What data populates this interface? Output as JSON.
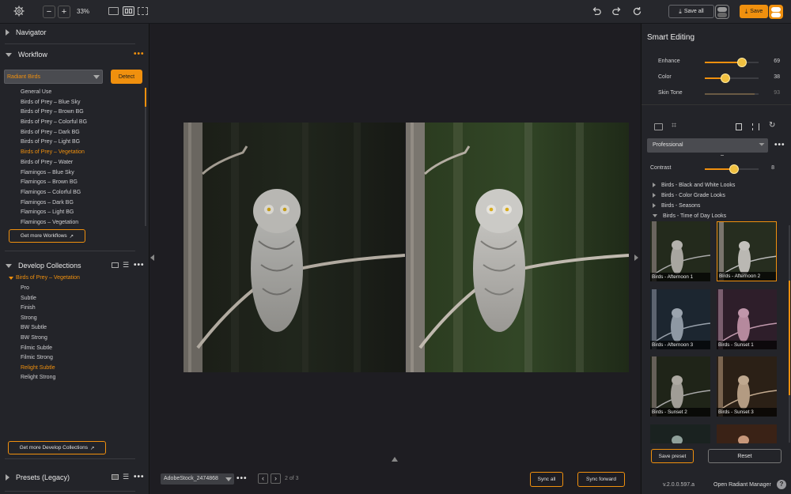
{
  "toolbar": {
    "zoom": "33%",
    "save_all_label": "Save all",
    "save_label": "Save"
  },
  "navigator": {
    "title": "Navigator"
  },
  "workflow": {
    "title": "Workflow",
    "selected": "Radiant Birds",
    "detect_label": "Detect",
    "items": [
      "General Use",
      "Birds of Prey – Blue Sky",
      "Birds of Prey – Brown BG",
      "Birds of Prey – Colorful BG",
      "Birds of Prey – Dark BG",
      "Birds of Prey – Light BG",
      "Birds of Prey – Vegetation",
      "Birds of Prey – Water",
      "Flamingos – Blue Sky",
      "Flamingos – Brown BG",
      "Flamingos – Colorful BG",
      "Flamingos – Dark BG",
      "Flamingos – Light BG",
      "Flamingos – Vegetation"
    ],
    "get_more_label": "Get more Workflows"
  },
  "develop": {
    "title": "Develop Collections",
    "group": "Birds of Prey – Vegetation",
    "items": [
      "Pro",
      "Subtle",
      "Finish",
      "Strong",
      "BW Subtle",
      "BW Strong",
      "Filmic Subtle",
      "Filmic Strong",
      "Relight Subtle",
      "Relight Strong"
    ],
    "get_more_label": "Get more Develop Collections"
  },
  "presets": {
    "title": "Presets (Legacy)"
  },
  "bottom": {
    "filename": "AdobeStock_2474868",
    "page": "2 of 3",
    "sync_all": "Sync all",
    "sync_forward": "Sync forward"
  },
  "smart": {
    "title": "Smart Editing",
    "sliders": [
      {
        "label": "Enhance",
        "value": 69
      },
      {
        "label": "Color",
        "value": 38
      },
      {
        "label": "Skin Tone",
        "value": 93
      }
    ],
    "profile": "Professional",
    "contrast_label": "Contrast",
    "contrast_value": 8,
    "looks": [
      {
        "label": "Birds - Black and White Looks",
        "open": false
      },
      {
        "label": "Birds - Color Grade Looks",
        "open": false
      },
      {
        "label": "Birds - Seasons",
        "open": false
      },
      {
        "label": "Birds - Time of Day Looks",
        "open": true
      }
    ],
    "thumbs": [
      "Birds - Afternoon 1",
      "Birds - Afternoon 2",
      "Birds - Afternoon 3",
      "Birds - Sunset 1",
      "Birds - Sunset 2",
      "Birds - Sunset 3"
    ],
    "save_preset": "Save preset",
    "reset": "Reset"
  },
  "footer": {
    "version": "v.2.0.0.597.a",
    "manager": "Open Radiant Manager",
    "help": "?"
  },
  "colors": {
    "accent": "#f0900e",
    "panel": "#232429",
    "canvas": "#1e1d22"
  }
}
